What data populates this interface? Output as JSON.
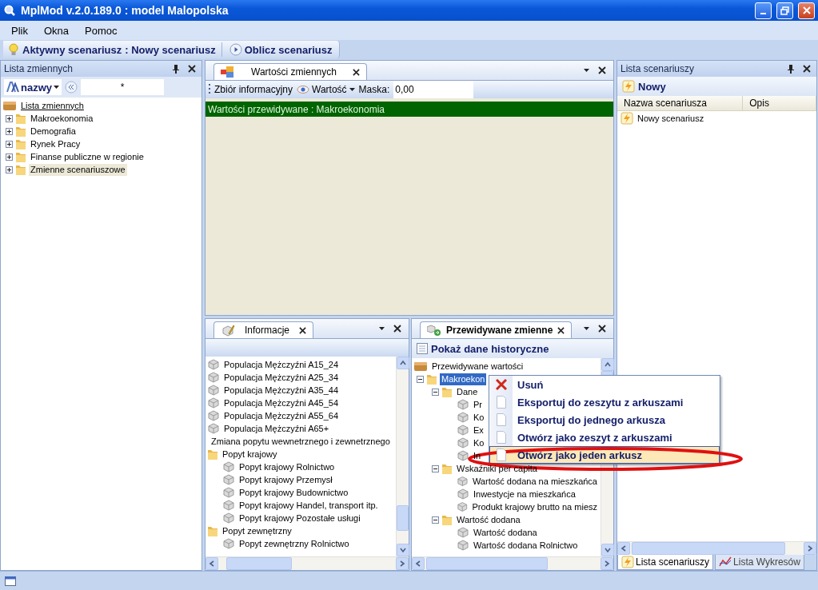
{
  "window": {
    "title": "MplMod v.2.0.189.0 : model Malopolska"
  },
  "menu": [
    "Plik",
    "Okna",
    "Pomoc"
  ],
  "toolbar": {
    "active_label": "Aktywny scenariusz",
    "active_value": ": Nowy scenariusz",
    "compute_button": "Oblicz scenariusz"
  },
  "variables_panel": {
    "title": "Lista zmiennych",
    "sort_button": "nazwy",
    "filter": "*",
    "root": {
      "label": "Lista zmiennych",
      "kind": "root",
      "selected": false,
      "children": [
        {
          "label": "Makroekonomia",
          "kind": "folder",
          "expanded": false,
          "selected": false
        },
        {
          "label": "Demografia",
          "kind": "folder",
          "expanded": false,
          "selected": false
        },
        {
          "label": "Rynek Pracy",
          "kind": "folder",
          "expanded": false,
          "selected": false
        },
        {
          "label": "Finanse publiczne w regionie",
          "kind": "folder",
          "expanded": false,
          "selected": false
        },
        {
          "label": "Zmienne scenariuszowe",
          "kind": "folder",
          "expanded": false,
          "selected": true
        }
      ]
    }
  },
  "values_doc": {
    "tab": "Wartości zmiennych",
    "info_set": "Zbiór informacyjny",
    "value_button": "Wartość",
    "mask_label": "Maska:",
    "mask_value": "0,00",
    "header": "Wartości przewidywane : Makroekonomia"
  },
  "info_panel": {
    "tab": "Informacje",
    "items": [
      {
        "label": "Populacja Mężczyźni A15_24",
        "kind": "item",
        "selected": false
      },
      {
        "label": "Populacja Mężczyźni A25_34",
        "kind": "item",
        "selected": false
      },
      {
        "label": "Populacja Mężczyźni A35_44",
        "kind": "item",
        "selected": false
      },
      {
        "label": "Populacja Mężczyźni A45_54",
        "kind": "item",
        "selected": false
      },
      {
        "label": "Populacja Mężczyźni A55_64",
        "kind": "item",
        "selected": false
      },
      {
        "label": "Populacja Mężczyźni A65+",
        "kind": "item",
        "selected": false
      },
      {
        "label": "Zmiana popytu wewnetrznego i zewnetrznego",
        "kind": "heading",
        "selected": false
      },
      {
        "label": "Popyt krajowy",
        "kind": "folder",
        "selected": false,
        "children": [
          {
            "label": "Popyt krajowy Rolnictwo",
            "kind": "item",
            "selected": false
          },
          {
            "label": "Popyt krajowy Przemysł",
            "kind": "item",
            "selected": false
          },
          {
            "label": "Popyt krajowy Budownictwo",
            "kind": "item",
            "selected": false
          },
          {
            "label": "Popyt krajowy Handel, transport itp.",
            "kind": "item",
            "selected": false
          },
          {
            "label": "Popyt krajowy Pozostałe usługi",
            "kind": "item",
            "selected": false
          }
        ]
      },
      {
        "label": "Popyt zewnętrzny",
        "kind": "folder",
        "selected": false,
        "children": [
          {
            "label": "Popyt zewnętrzny Rolnictwo",
            "kind": "item",
            "selected": false
          }
        ]
      }
    ]
  },
  "forecast_panel": {
    "tab": "Przewidywane zmienne",
    "history_button": "Pokaż dane historyczne",
    "root": {
      "label": "Przewidywane wartości",
      "kind": "root",
      "selected": false,
      "children": [
        {
          "label": "Makroekon",
          "kind": "folder",
          "expanded": true,
          "selected": true,
          "children": [
            {
              "label": "Dane",
              "kind": "folder",
              "expanded": true,
              "selected": false,
              "children": [
                {
                  "label": "Pr",
                  "kind": "item",
                  "selected": false
                },
                {
                  "label": "Ko",
                  "kind": "item",
                  "selected": false
                },
                {
                  "label": "Ex",
                  "kind": "item",
                  "selected": false
                },
                {
                  "label": "Ko",
                  "kind": "item",
                  "selected": false
                },
                {
                  "label": "In",
                  "kind": "item",
                  "selected": false
                }
              ]
            },
            {
              "label": "Wskaźniki per capita",
              "kind": "folder",
              "expanded": true,
              "selected": false,
              "children": [
                {
                  "label": "Wartość dodana na mieszkańca",
                  "kind": "item",
                  "selected": false
                },
                {
                  "label": "Inwestycje na mieszkańca",
                  "kind": "item",
                  "selected": false
                },
                {
                  "label": "Produkt krajowy brutto na miesz",
                  "kind": "item",
                  "selected": false
                }
              ]
            },
            {
              "label": "Wartość dodana",
              "kind": "folder",
              "expanded": true,
              "selected": false,
              "children": [
                {
                  "label": "Wartość dodana",
                  "kind": "item",
                  "selected": false
                },
                {
                  "label": "Wartość dodana Rolnictwo",
                  "kind": "item",
                  "selected": false
                }
              ]
            }
          ]
        }
      ]
    }
  },
  "context_menu": {
    "items": [
      {
        "label": "Usuń",
        "kind": "delete",
        "selected": false
      },
      {
        "label": "Eksportuj do zeszytu z arkuszami",
        "kind": "document",
        "selected": false
      },
      {
        "label": "Eksportuj do jednego arkusza",
        "kind": "document",
        "selected": false
      },
      {
        "label": "Otwórz jako zeszyt z arkuszami",
        "kind": "document",
        "selected": false
      },
      {
        "label": "Otwórz jako jeden arkusz",
        "kind": "document",
        "selected": true
      }
    ]
  },
  "scenarios_panel": {
    "title": "Lista scenariuszy",
    "new_button": "Nowy",
    "columns": [
      "Nazwa scenariusza",
      "Opis"
    ],
    "rows": [
      {
        "name": "Nowy scenariusz",
        "selected": false
      }
    ],
    "tabs": [
      {
        "label": "Lista scenariuszy",
        "selected": true
      },
      {
        "label": "Lista Wykresów",
        "selected": false
      }
    ]
  }
}
